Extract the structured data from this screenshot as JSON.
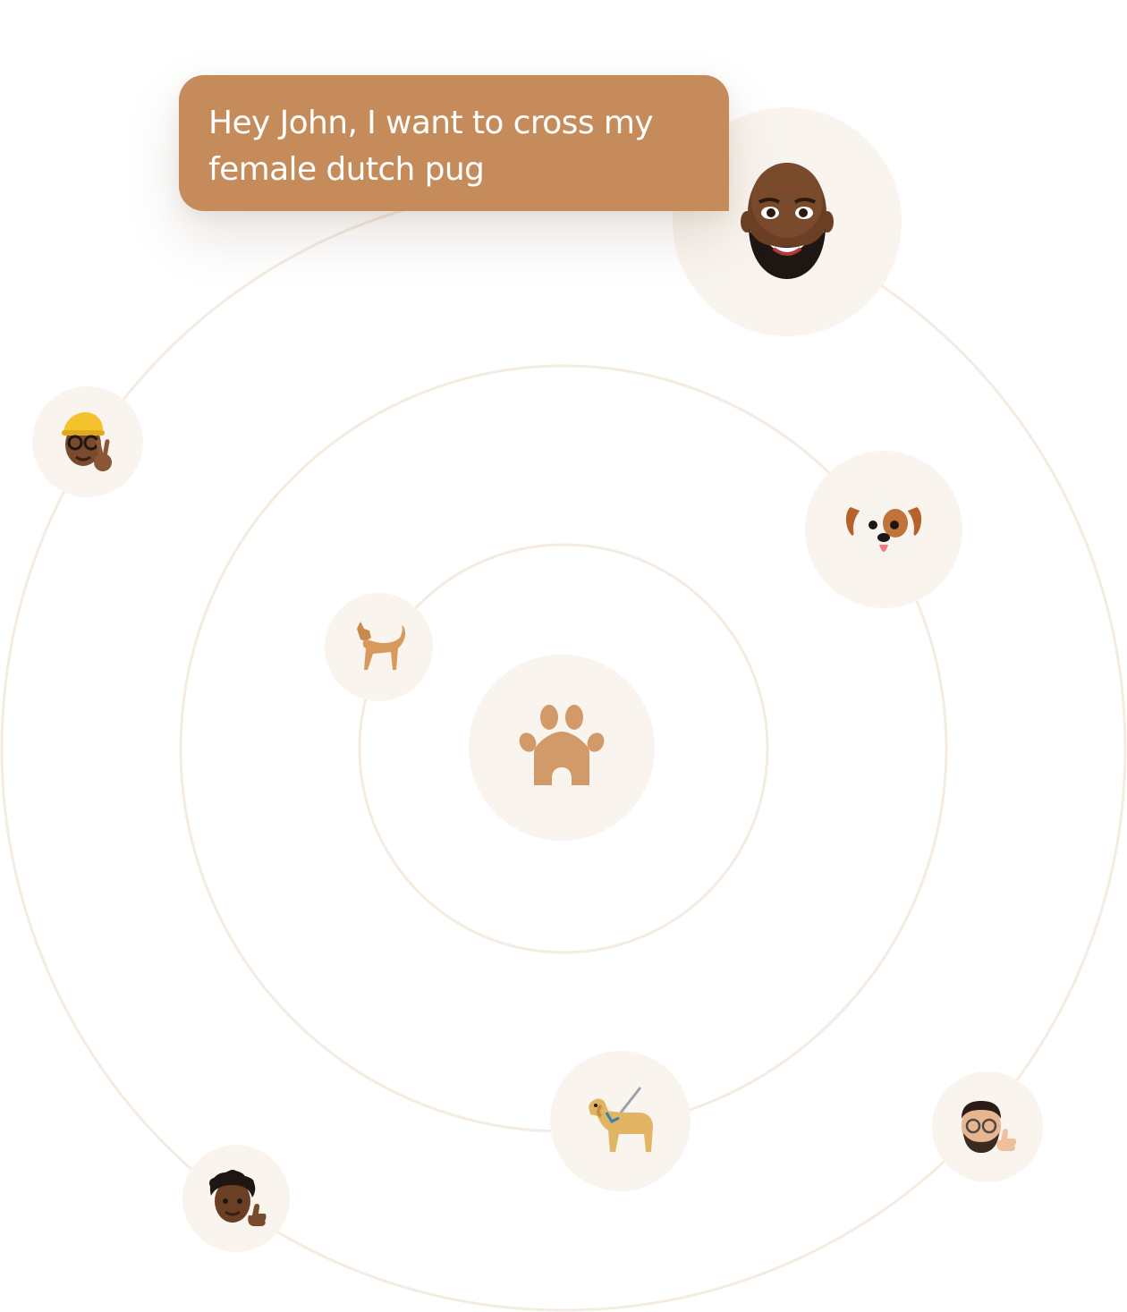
{
  "chat": {
    "message": "Hey John, I want to cross my female dutch pug"
  },
  "colors": {
    "accent": "#c58b5a",
    "bubble_bg": "#f9f4ee",
    "orbit_line": "#f4ebe1",
    "paw": "#d39a69"
  },
  "avatars": [
    {
      "name": "john-memoji-avatar",
      "icon": "bald-bearded-man-memoji"
    },
    {
      "name": "yellow-cap-memoji-avatar",
      "icon": "peace-sign-cap-memoji"
    },
    {
      "name": "puppy-face-avatar",
      "icon": "dog-face-emoji"
    },
    {
      "name": "dog-avatar",
      "icon": "dog-emoji"
    },
    {
      "name": "guide-dog-avatar",
      "icon": "guide-dog-emoji"
    },
    {
      "name": "glasses-man-memoji-avatar",
      "icon": "thumbs-up-glasses-memoji"
    },
    {
      "name": "curly-hair-memoji-avatar",
      "icon": "thumbs-up-curly-memoji"
    }
  ],
  "center": {
    "icon": "paw-house-icon"
  }
}
